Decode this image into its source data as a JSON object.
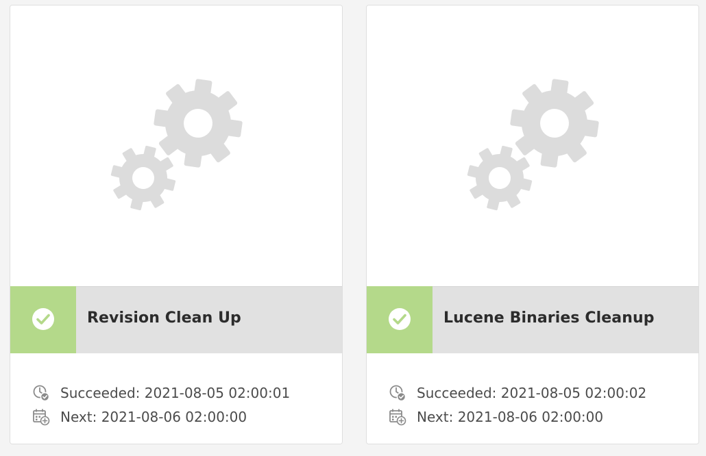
{
  "colors": {
    "page_background": "#f4f4f4",
    "card_background": "#ffffff",
    "title_bar": "#e1e1e1",
    "status_success": "#b4d98a",
    "gear_icon": "#dcdcdc",
    "text": "#4b4b4b"
  },
  "cards": [
    {
      "title": "Revision Clean Up",
      "status": "success",
      "thumbnail_icon": "gears-icon",
      "succeeded_label": "Succeeded:",
      "succeeded_value": "2021-08-05 02:00:01",
      "next_label": "Next:",
      "next_value": "2021-08-06 02:00:00"
    },
    {
      "title": "Lucene Binaries Cleanup",
      "status": "success",
      "thumbnail_icon": "gears-icon",
      "succeeded_label": "Succeeded:",
      "succeeded_value": "2021-08-05 02:00:02",
      "next_label": "Next:",
      "next_value": "2021-08-06 02:00:00"
    }
  ]
}
